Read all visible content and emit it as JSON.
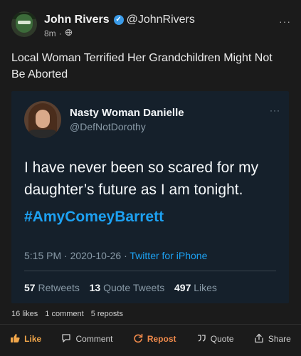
{
  "post": {
    "author_name": "John Rivers",
    "author_handle": "@JohnRivers",
    "time": "8m",
    "time_sep": "·",
    "globe_icon": "globe-icon",
    "more": "···",
    "text": "Local Woman Terrified Her Grandchildren Might Not Be Aborted"
  },
  "tweet": {
    "name": "Nasty Woman Danielle",
    "handle": "@DefNotDorothy",
    "more": "···",
    "body": "I have never been so scared for my daughter’s future as I am tonight.",
    "hashtag": "#AmyComeyBarrett",
    "time": "5:15 PM",
    "date": "2020-10-26",
    "sep": "·",
    "source": "Twitter for iPhone",
    "retweets_count": "57",
    "retweets_label": "Retweets",
    "quotes_count": "13",
    "quotes_label": "Quote Tweets",
    "likes_count": "497",
    "likes_label": "Likes"
  },
  "engagement": {
    "likes": "16 likes",
    "comments": "1 comment",
    "reposts": "5 reposts"
  },
  "actions": [
    {
      "label": "Like",
      "icon": "thumbs-up-icon"
    },
    {
      "label": "Comment",
      "icon": "comment-icon"
    },
    {
      "label": "Repost",
      "icon": "repost-icon"
    },
    {
      "label": "Quote",
      "icon": "quote-icon"
    },
    {
      "label": "Share",
      "icon": "share-icon"
    }
  ],
  "colors": {
    "background": "#1b1b1b",
    "tweet_background": "#15202b",
    "twitter_blue": "#1da1f2",
    "like_accent": "#f1a64a",
    "repost_accent": "#f08a4b"
  }
}
